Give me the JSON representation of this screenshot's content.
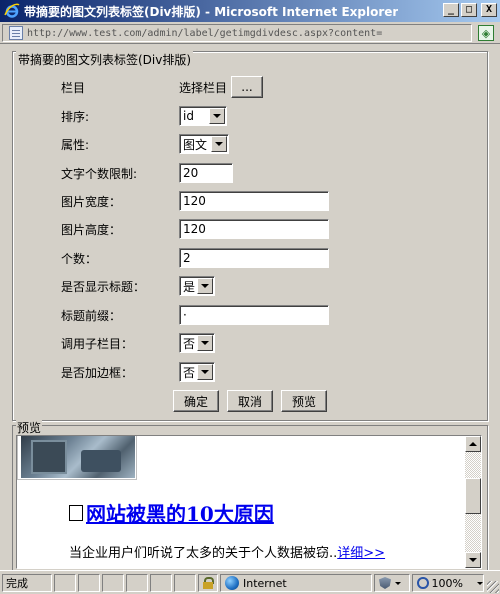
{
  "window": {
    "title": "带摘要的图文列表标签(Div排版) - Microsoft Internet Explorer",
    "minimize": "_",
    "maximize": "□",
    "close": "X"
  },
  "address": {
    "url": "http://www.test.com/admin/label/getimgdivdesc.aspx?content="
  },
  "form": {
    "legend": "带摘要的图文列表标签(Div排版)",
    "column_label": "栏目",
    "column_select_text": "选择栏目",
    "column_browse_button": "...",
    "sort_label": "排序:",
    "sort_value": "id",
    "attr_label": "属性:",
    "attr_value": "图文",
    "text_limit_label": "文字个数限制:",
    "text_limit_value": "20",
    "img_width_label": "图片宽度：",
    "img_width_value": "120",
    "img_height_label": "图片高度：",
    "img_height_value": "120",
    "count_label": "个数：",
    "count_value": "2",
    "show_title_label": "是否显示标题：",
    "show_title_value": "是",
    "title_prefix_label": "标题前缀：",
    "title_prefix_value": "·",
    "sub_column_label": "调用子栏目：",
    "sub_column_value": "否",
    "border_label": "是否加边框：",
    "border_value": "否",
    "ok_button": "确定",
    "cancel_button": "取消",
    "preview_button": "预览"
  },
  "preview": {
    "legend": "预览",
    "article_title": "网站被黑的10大原因",
    "summary": "当企业用户们听说了太多的关于个人数据被窃..",
    "more_link": "详细>>"
  },
  "status": {
    "text": "完成",
    "zone": "Internet",
    "zoom": "100%"
  },
  "colors": {
    "titlebar_start": "#0a246a",
    "titlebar_end": "#a6caf0",
    "link": "#0000ee",
    "chrome": "#d4d0c8"
  }
}
